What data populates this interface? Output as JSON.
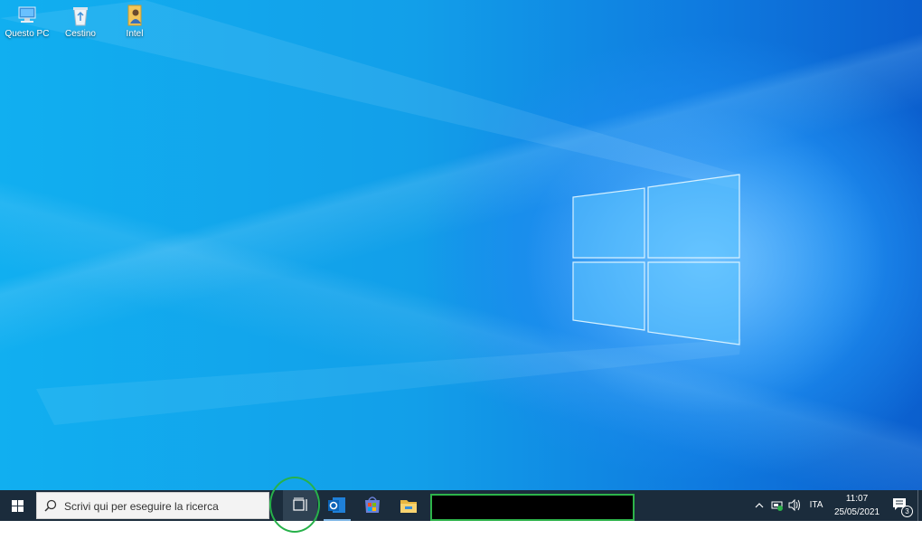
{
  "desktop": {
    "icons": [
      {
        "label": "Questo PC",
        "icon": "this-pc-icon"
      },
      {
        "label": "Cestino",
        "icon": "recycle-bin-icon"
      },
      {
        "label": "Intel",
        "icon": "user-folder-icon"
      }
    ],
    "wallpaper": "windows-10-hero",
    "colors": {
      "wallpaper_light": "#11aff0",
      "wallpaper_dark": "#0b5fce"
    }
  },
  "taskbar": {
    "search_placeholder": "Scrivi qui per eseguire la ricerca",
    "pinned": [
      "task-view-icon",
      "outlook-icon",
      "store-icon",
      "file-explorer-icon"
    ],
    "tray": {
      "language": "ITA",
      "time": "11:07",
      "date": "25/05/2021",
      "notification_count": "3"
    },
    "colors": {
      "background": "#1b2c3c",
      "annotation": "#27b14a"
    }
  }
}
